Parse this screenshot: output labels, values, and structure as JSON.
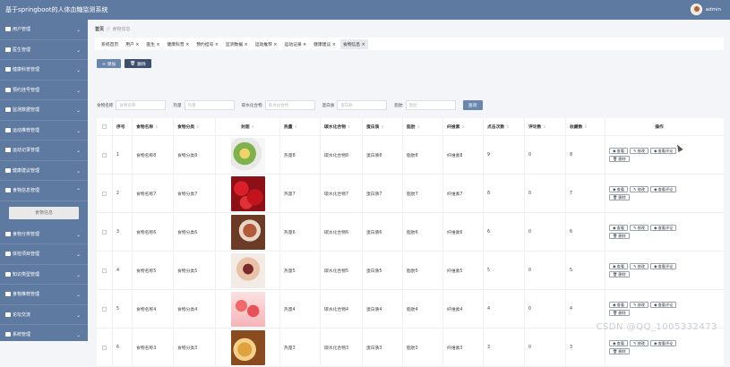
{
  "app": {
    "title": "基于springboot的人体血糖监测系统",
    "user": "admin"
  },
  "breadcrumb": {
    "home": "首页",
    "current": "食物信息"
  },
  "sidebar": {
    "items": [
      {
        "label": "用户管理"
      },
      {
        "label": "医生管理"
      },
      {
        "label": "健康科普管理"
      },
      {
        "label": "预约挂号管理"
      },
      {
        "label": "监测数据管理"
      },
      {
        "label": "运动推荐管理"
      },
      {
        "label": "运动记录管理"
      },
      {
        "label": "健康建议管理"
      },
      {
        "label": "食物信息管理"
      }
    ],
    "sub_item": "食物信息",
    "items_after": [
      {
        "label": "食物分类管理"
      },
      {
        "label": "体检项目管理"
      },
      {
        "label": "知识类型管理"
      },
      {
        "label": "食物推荐管理"
      },
      {
        "label": "论坛交流"
      },
      {
        "label": "系统管理"
      }
    ]
  },
  "tabs": [
    {
      "label": "系统首页"
    },
    {
      "label": "用户 ×"
    },
    {
      "label": "医生 ×"
    },
    {
      "label": "健康科普 ×"
    },
    {
      "label": "预约挂号 ×"
    },
    {
      "label": "监测数据 ×"
    },
    {
      "label": "运动推荐 ×"
    },
    {
      "label": "运动记录 ×"
    },
    {
      "label": "健康建议 ×"
    },
    {
      "label": "食物信息 ×"
    }
  ],
  "toolbar": {
    "add": "+ 添加",
    "delete": "删除"
  },
  "search": {
    "fields": [
      {
        "label": "食物名称",
        "placeholder": "食物名称"
      },
      {
        "label": "热量",
        "placeholder": "热量"
      },
      {
        "label": "碳水化合物",
        "placeholder": "碳水化合物"
      },
      {
        "label": "蛋白质",
        "placeholder": "蛋白质"
      },
      {
        "label": "脂肪",
        "placeholder": "脂肪"
      }
    ],
    "button": "查询"
  },
  "table": {
    "headers": [
      "序号",
      "食物名称",
      "食物分类",
      "封面",
      "热量",
      "碳水化合物",
      "蛋白质",
      "脂肪",
      "纤维素",
      "点击次数",
      "评论数",
      "收藏数",
      "操作"
    ],
    "rows": [
      {
        "no": "1",
        "name": "食物名称8",
        "cat": "食物分类8",
        "heat": "热量8",
        "carb": "碳水化合物8",
        "protein": "蛋白质8",
        "fat": "脂肪8",
        "fiber": "纤维素8",
        "clicks": "9",
        "comments": "0",
        "fav": "8",
        "cover": "salad-image"
      },
      {
        "no": "2",
        "name": "食物名称7",
        "cat": "食物分类7",
        "heat": "热量7",
        "carb": "碳水化合物7",
        "protein": "蛋白质7",
        "fat": "脂肪7",
        "fiber": "纤维素7",
        "clicks": "8",
        "comments": "0",
        "fav": "7",
        "cover": "strawberry-image"
      },
      {
        "no": "3",
        "name": "食物名称6",
        "cat": "食物分类6",
        "heat": "热量6",
        "carb": "碳水化合物6",
        "protein": "蛋白质6",
        "fat": "脂肪6",
        "fiber": "纤维素6",
        "clicks": "6",
        "comments": "0",
        "fav": "6",
        "cover": "meat-image"
      },
      {
        "no": "4",
        "name": "食物名称5",
        "cat": "食物分类5",
        "heat": "热量5",
        "carb": "碳水化合物5",
        "protein": "蛋白质5",
        "fat": "脂肪5",
        "fiber": "纤维素5",
        "clicks": "5",
        "comments": "0",
        "fav": "5",
        "cover": "cake-image"
      },
      {
        "no": "5",
        "name": "食物名称4",
        "cat": "食物分类4",
        "heat": "热量4",
        "carb": "碳水化合物4",
        "protein": "蛋白质4",
        "fat": "脂肪4",
        "fiber": "纤维素4",
        "clicks": "4",
        "comments": "0",
        "fav": "4",
        "cover": "macaron-image"
      },
      {
        "no": "6",
        "name": "食物名称3",
        "cat": "食物分类3",
        "heat": "热量3",
        "carb": "碳水化合物3",
        "protein": "蛋白质3",
        "fat": "脂肪3",
        "fiber": "纤维素3",
        "clicks": "3",
        "comments": "0",
        "fav": "3",
        "cover": "fried-food-image"
      }
    ],
    "ops": {
      "view": "查看",
      "edit": "修改",
      "comment": "查看评论",
      "delete": "删除"
    }
  },
  "watermark": "CSDN @QQ_1005332473"
}
